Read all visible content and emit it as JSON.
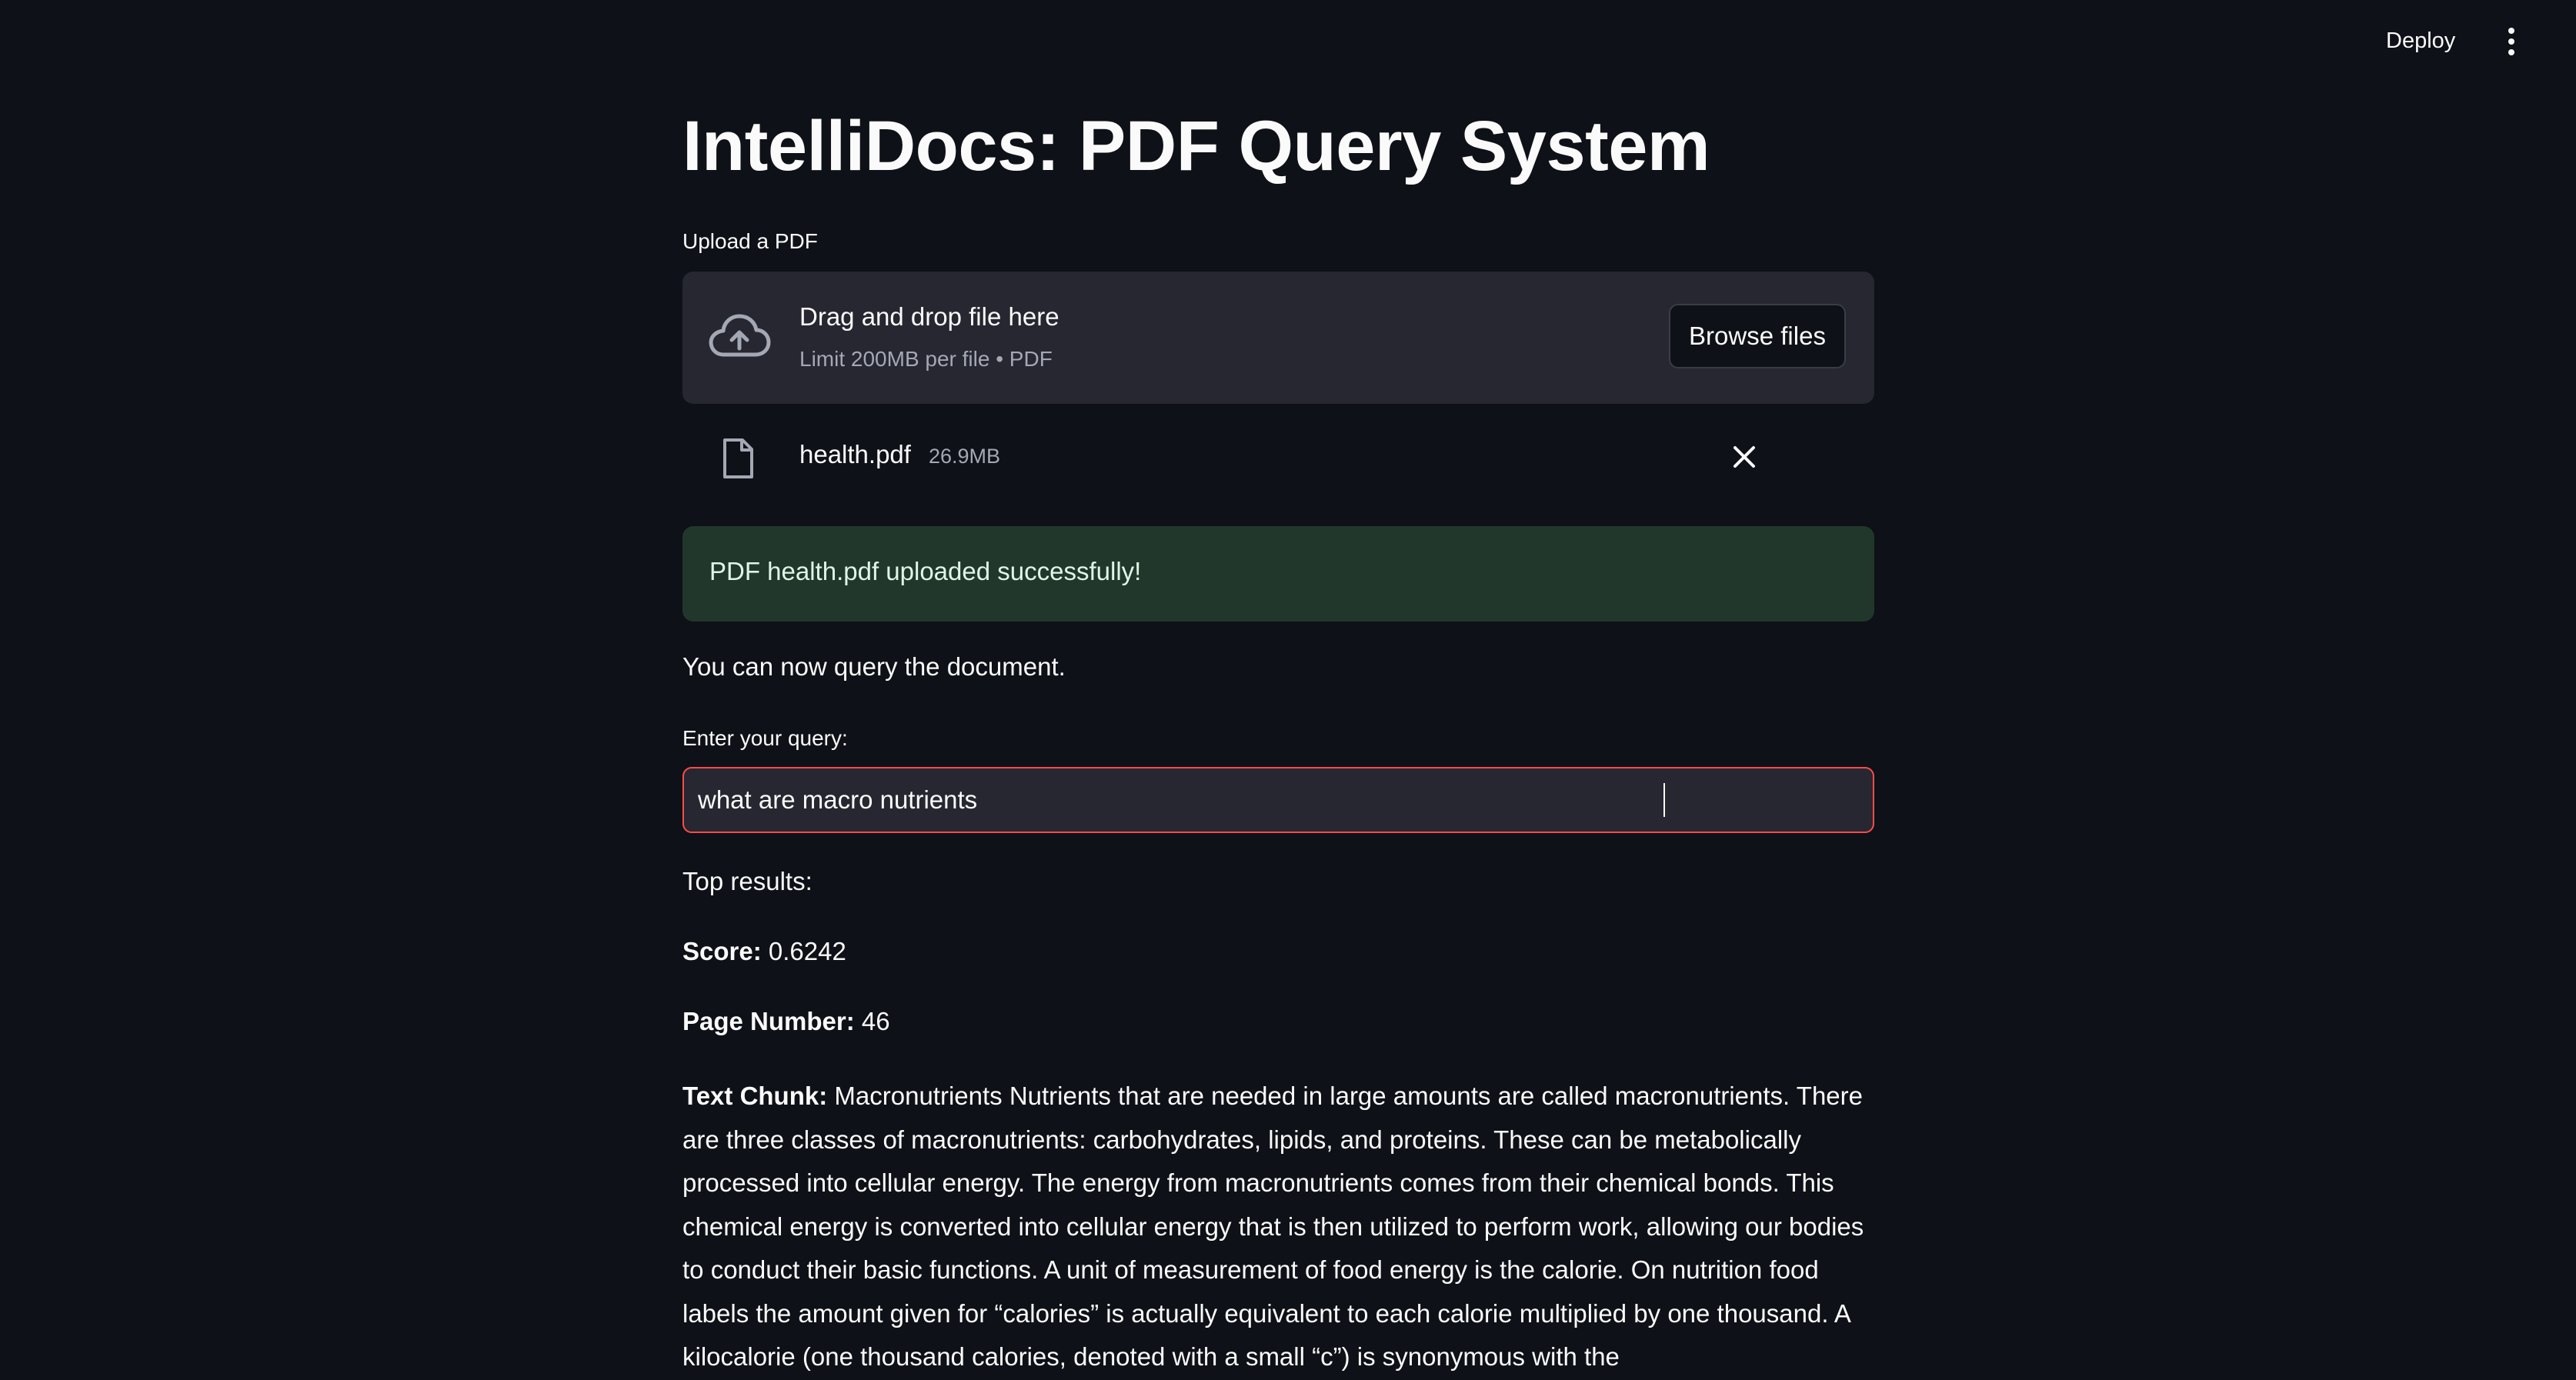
{
  "header": {
    "deploy_label": "Deploy",
    "menu_icon": "kebab-menu-icon"
  },
  "page": {
    "title": "IntelliDocs: PDF Query System"
  },
  "uploader": {
    "label": "Upload a PDF",
    "drop_title": "Drag and drop file here",
    "drop_subtitle": "Limit 200MB per file • PDF",
    "browse_label": "Browse files",
    "upload_icon": "cloud-upload-icon",
    "file": {
      "name": "health.pdf",
      "size": "26.9MB",
      "icon": "file-icon",
      "remove_icon": "close-icon"
    }
  },
  "status": {
    "success_message": "PDF health.pdf uploaded successfully!",
    "info_text": "You can now query the document."
  },
  "query": {
    "label": "Enter your query:",
    "value": "what are macro nutrients"
  },
  "results": {
    "heading": "Top results:",
    "score_label": "Score:",
    "score_value": "0.6242",
    "page_label": "Page Number:",
    "page_value": "46",
    "chunk_label": "Text Chunk:",
    "chunk_text": "Macronutrients Nutrients that are needed in large amounts are called macronutrients. There are three classes of macronutrients: carbohydrates, lipids, and proteins. These can be metabolically processed into cellular energy. The energy from macronutrients comes from their chemical bonds. This chemical energy is converted into cellular energy that is then utilized to perform work, allowing our bodies to conduct their basic functions. A unit of measurement of food energy is the calorie. On nutrition food labels the amount given for “calories” is actually equivalent to each calorie multiplied by one thousand. A kilocalorie (one thousand calories, denoted with a small “c”) is synonymous with the"
  },
  "colors": {
    "background": "#0e1117",
    "surface": "#262730",
    "success_bg": "#21372b",
    "input_focus_border": "#ff4b4b",
    "text": "#fafafa",
    "muted_text": "#a3a8b4"
  }
}
